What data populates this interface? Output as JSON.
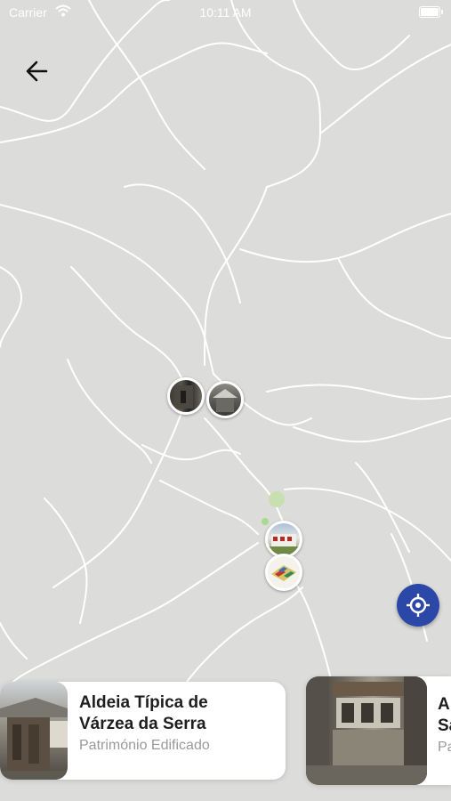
{
  "status_bar": {
    "carrier": "Carrier",
    "time": "10:11 AM"
  },
  "map": {
    "pins": [
      "heritage-photo-1",
      "heritage-photo-2",
      "heritage-photo-3",
      "heritage-photo-4"
    ]
  },
  "cards": [
    {
      "title_line1": "Aldeia Típica de",
      "title_line2": "Várzea da Serra",
      "category": "Património Edificado"
    },
    {
      "title_line1": "A",
      "title_line2": "Sa",
      "category": "Pa"
    }
  ],
  "colors": {
    "map_bg": "#dcdcdb",
    "road": "#ffffff",
    "accent": "#2b48a8"
  }
}
